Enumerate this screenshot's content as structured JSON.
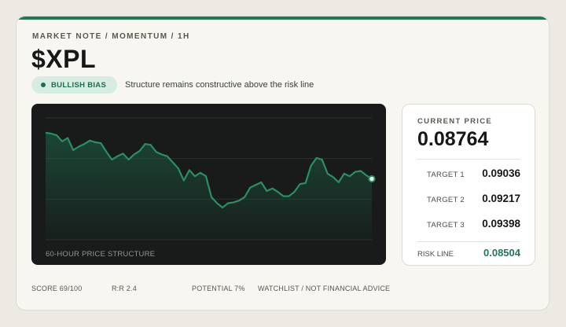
{
  "header": {
    "eyebrow": "MARKET NOTE / MOMENTUM / 1H",
    "ticker": "$XPL",
    "bias_badge": "BULLISH BIAS",
    "subline": "Structure remains constructive above the risk line"
  },
  "chart": {
    "caption": "60-HOUR PRICE STRUCTURE"
  },
  "chart_data": {
    "type": "area",
    "title": "",
    "x": [
      1,
      2,
      3,
      4,
      5,
      6,
      7,
      8,
      9,
      10,
      11,
      12,
      13,
      14,
      15,
      16,
      17,
      18,
      19,
      20,
      21,
      22,
      23,
      24,
      25,
      26,
      27,
      28,
      29,
      30,
      31,
      32,
      33,
      34,
      35,
      36,
      37,
      38,
      39,
      40,
      41,
      42,
      43,
      44,
      45,
      46,
      47,
      48,
      49,
      50,
      51,
      52,
      53,
      54,
      55,
      56,
      57,
      58,
      59,
      60
    ],
    "series": [
      {
        "values": [
          0.0903,
          0.0902,
          0.09,
          0.0893,
          0.0897,
          0.0883,
          0.0887,
          0.089,
          0.0894,
          0.0892,
          0.0891,
          0.0881,
          0.0872,
          0.0876,
          0.0879,
          0.0872,
          0.0878,
          0.0882,
          0.089,
          0.0889,
          0.0881,
          0.0878,
          0.0876,
          0.0869,
          0.0862,
          0.0848,
          0.086,
          0.0853,
          0.0857,
          0.0853,
          0.0829,
          0.0822,
          0.0817,
          0.0822,
          0.0823,
          0.0825,
          0.0829,
          0.084,
          0.0843,
          0.0846,
          0.0836,
          0.0839,
          0.0835,
          0.083,
          0.083,
          0.0835,
          0.0844,
          0.0845,
          0.0865,
          0.0874,
          0.0872,
          0.0856,
          0.0852,
          0.0846,
          0.0856,
          0.0853,
          0.0858,
          0.0859,
          0.0854,
          0.085
        ]
      }
    ],
    "ylim": [
      0.078,
      0.092
    ],
    "grid": true,
    "last_point_marker": true,
    "colors": {
      "line": "#2a8f63",
      "fill": "#1f7a57",
      "background": "#181b1a",
      "grid": "#2b302d"
    }
  },
  "quote": {
    "label": "CURRENT PRICE",
    "value": "0.08764",
    "targets": [
      {
        "label": "TARGET 1",
        "value": "0.09036"
      },
      {
        "label": "TARGET 2",
        "value": "0.09217"
      },
      {
        "label": "TARGET 3",
        "value": "0.09398"
      }
    ],
    "risk_label": "RISK LINE",
    "risk_value": "0.08504"
  },
  "footer": {
    "score": "SCORE 69/100",
    "rr": "R:R 2.4",
    "potential": "POTENTIAL 7%",
    "disclaimer": "WATCHLIST / NOT FINANCIAL ADVICE"
  },
  "theme": {
    "accent": "#1f7a57",
    "badge_bg": "#d7ece2"
  }
}
